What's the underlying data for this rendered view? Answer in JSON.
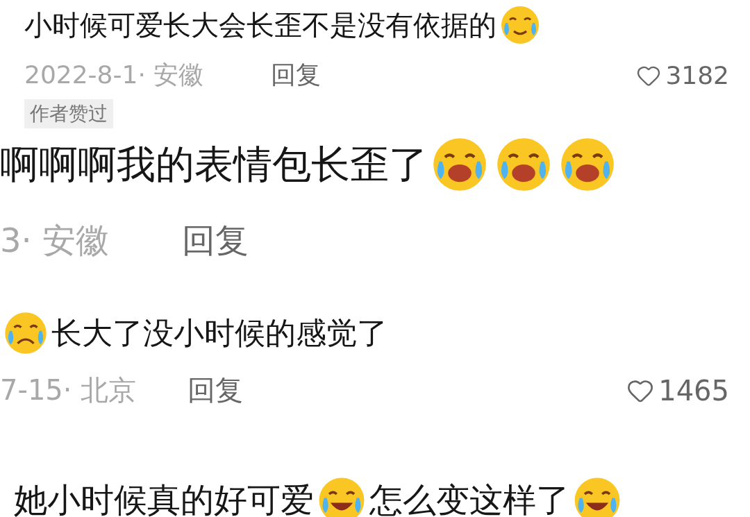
{
  "comments": [
    {
      "segments": [
        {
          "kind": "text",
          "text": "小时候可爱长大会长歪不是没有依据的"
        },
        {
          "kind": "teary"
        }
      ],
      "date": "2022-8-1· 安徽",
      "reply": "回复",
      "likes": "3182"
    },
    {
      "badge": "作者赞过",
      "segments": [
        {
          "kind": "text",
          "text": "啊啊啊我的表情包长歪了"
        },
        {
          "kind": "wail"
        },
        {
          "kind": "wail"
        },
        {
          "kind": "wail"
        }
      ],
      "date": "3· 安徽",
      "reply": "回复"
    },
    {
      "segments": [
        {
          "kind": "cry"
        },
        {
          "kind": "text",
          "text": "长大了没小时候的感觉了"
        }
      ],
      "date": "7-15· 北京",
      "reply": "回复",
      "likes": "1465"
    },
    {
      "segments": [
        {
          "kind": "text",
          "text": "她小时候真的好可爱"
        },
        {
          "kind": "laugh"
        },
        {
          "kind": "text",
          "text": "怎么变这样了"
        },
        {
          "kind": "laugh"
        }
      ]
    }
  ]
}
